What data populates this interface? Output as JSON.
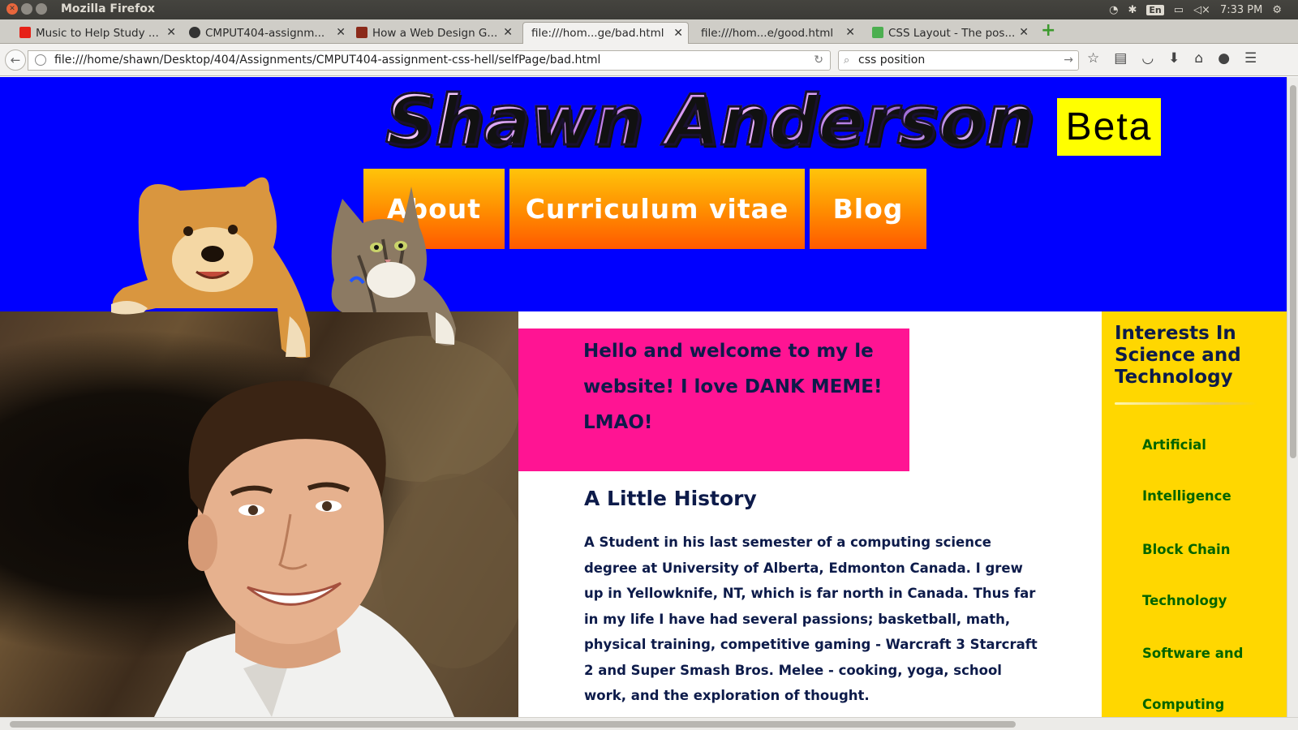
{
  "window": {
    "title": "Mozilla Firefox",
    "tray": {
      "lang": "En",
      "time": "7:33 PM"
    }
  },
  "tabs": [
    {
      "label": "Music to Help Study ...",
      "favicon": "youtube-icon",
      "color": "#e62117",
      "active": false
    },
    {
      "label": "CMPUT404-assignm...",
      "favicon": "github-icon",
      "color": "#333333",
      "active": false
    },
    {
      "label": "How a Web Design G...",
      "favicon": "page-icon",
      "color": "#8b2a1a",
      "active": false
    },
    {
      "label": "file:///hom...ge/bad.html",
      "favicon": "",
      "color": "",
      "active": true
    },
    {
      "label": "file:///hom...e/good.html",
      "favicon": "",
      "color": "",
      "active": false
    },
    {
      "label": "CSS Layout - The pos...",
      "favicon": "w3schools-icon",
      "color": "#4caf50",
      "active": false
    }
  ],
  "navbar": {
    "url": "file:///home/shawn/Desktop/404/Assignments/CMPUT404-assignment-css-hell/selfPage/bad.html",
    "search_value": "css position"
  },
  "page": {
    "site_title": "Shawn Anderson",
    "beta": "Beta",
    "menu": [
      {
        "label": "About"
      },
      {
        "label": "Curriculum vitae"
      },
      {
        "label": "Blog"
      }
    ],
    "welcome": "Hello and welcome to my le website! I love DANK MEME! LMAO!",
    "history_title": "A Little History",
    "history_body": "A Student in his last semester of a computing science degree at University of Alberta, Edmonton Canada. I grew up in Yellowknife, NT, which is far north in Canada. Thus far in my life I have had several passions; basketball, math, physical training, competitive gaming - Warcraft 3 Starcraft 2 and Super Smash Bros. Melee - cooking, yoga, school work, and the exploration of thought.",
    "sidebar": {
      "title": "Interests In Science and Technology",
      "items": [
        "Artificial",
        "Intelligence",
        "Block Chain",
        "Technology",
        "Software and",
        "Computing"
      ]
    },
    "colors": {
      "header_bg": "#0000ff",
      "beta_bg": "#ffff00",
      "welcome_bg": "#ff1493",
      "sidebar_bg": "#ffd700",
      "sidebar_link": "#006400"
    }
  }
}
